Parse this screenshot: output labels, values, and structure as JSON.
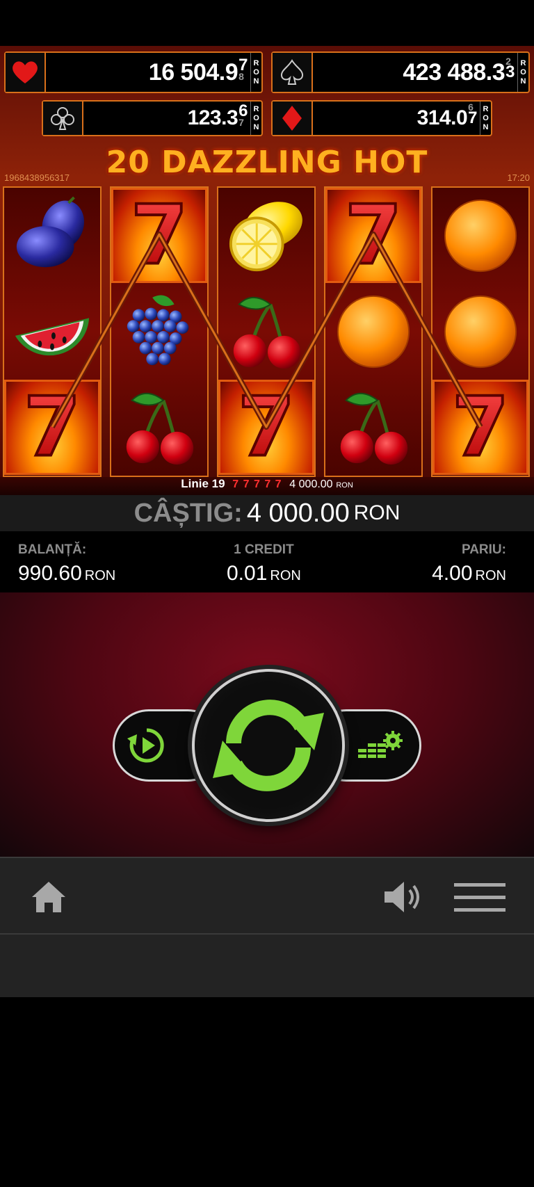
{
  "jackpots": {
    "hearts": {
      "main": "16 504.9",
      "digit": "7",
      "next_digit": "8",
      "currency": [
        "R",
        "O",
        "N"
      ]
    },
    "spades": {
      "main": "423 488.3",
      "prev_digit": "2",
      "digit": "3",
      "currency": [
        "R",
        "O",
        "N"
      ]
    },
    "clubs": {
      "main": "123.3",
      "digit": "6",
      "next_digit": "7",
      "currency": [
        "R",
        "O",
        "N"
      ]
    },
    "diamonds": {
      "main": "314.0",
      "prev_digit": "6",
      "digit": "7",
      "currency": [
        "R",
        "O",
        "N"
      ]
    }
  },
  "game": {
    "title": "20 DAZZLING HOT",
    "id": "1968438956317",
    "time": "17:20"
  },
  "reels": [
    [
      "plum",
      "watermelon",
      "seven"
    ],
    [
      "seven",
      "grapes",
      "cherry"
    ],
    [
      "lemon",
      "cherry",
      "seven"
    ],
    [
      "seven",
      "orange",
      "cherry"
    ],
    [
      "orange",
      "orange",
      "seven"
    ]
  ],
  "win_line": {
    "label": "Linie 19",
    "symbols": "7 7 7 7 7",
    "amount": "4 000.00",
    "currency": "RON"
  },
  "win": {
    "label": "CÂȘTIG:",
    "value": "4 000.00",
    "currency": "RON"
  },
  "stats": {
    "balance": {
      "label": "BALANȚĂ:",
      "value": "990.60",
      "currency": "RON"
    },
    "credit": {
      "label": "1 CREDIT",
      "value": "0.01",
      "currency": "RON"
    },
    "bet": {
      "label": "PARIU:",
      "value": "4.00",
      "currency": "RON"
    }
  },
  "controls": {
    "autoplay_icon": "autoplay-icon",
    "spin_icon": "spin-arrows-icon",
    "settings_icon": "bet-settings-icon"
  },
  "nav": {
    "home_icon": "home-icon",
    "sound_icon": "speaker-icon",
    "menu_icon": "hamburger-menu-icon"
  },
  "colors": {
    "accent_green": "#7fd63a",
    "frame_orange": "#d9701a",
    "title_gold": "#ffb020"
  }
}
